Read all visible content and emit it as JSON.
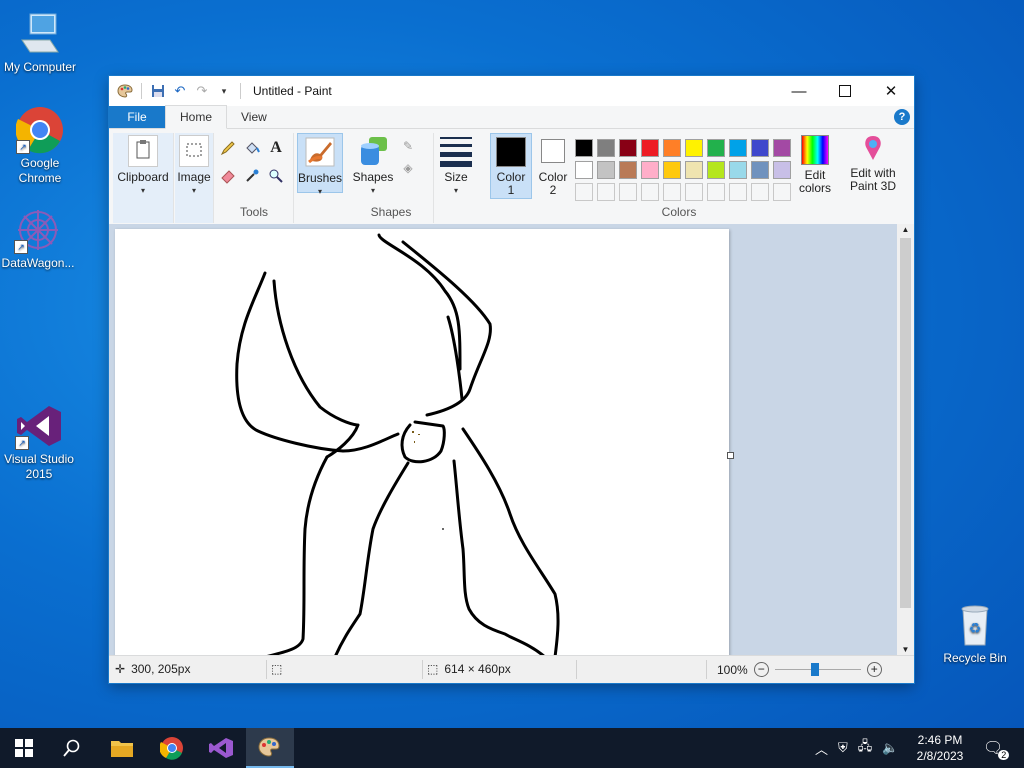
{
  "desktop": {
    "icons": [
      {
        "label": "My Computer",
        "icon": "computer-icon"
      },
      {
        "label": "Google Chrome",
        "icon": "chrome-icon"
      },
      {
        "label": "DataWagon...",
        "icon": "datawagon-icon"
      },
      {
        "label": "Visual Studio 2015",
        "icon": "visual-studio-icon"
      },
      {
        "label": "Recycle Bin",
        "icon": "recycle-bin-icon"
      }
    ]
  },
  "window": {
    "title": "Untitled - Paint",
    "tabs": [
      "File",
      "Home",
      "View"
    ],
    "active_tab": "Home",
    "ribbon": {
      "clipboard": "Clipboard",
      "image": "Image",
      "tools_group": "Tools",
      "brushes": "Brushes",
      "shapes": "Shapes",
      "shapes_group": "Shapes",
      "size": "Size",
      "color1_line1": "Color",
      "color1_line2": "1",
      "color2_line1": "Color",
      "color2_line2": "2",
      "colors_group": "Colors",
      "edit_colors_line1": "Edit",
      "edit_colors_line2": "colors",
      "paint3d_line1": "Edit with",
      "paint3d_line2": "Paint 3D"
    },
    "palette_row1": [
      "#000000",
      "#7f7f7f",
      "#880015",
      "#ed1c24",
      "#ff7f27",
      "#fff200",
      "#22b14c",
      "#00a2e8",
      "#3f48cc",
      "#a349a4"
    ],
    "palette_row2": [
      "#ffffff",
      "#c3c3c3",
      "#b97a57",
      "#ffaec9",
      "#ffc90e",
      "#efe4b0",
      "#b5e61d",
      "#99d9ea",
      "#7092be",
      "#c8bfe7"
    ],
    "color1": "#000000",
    "color2": "#ffffff",
    "status": {
      "cursor_pos": "300, 205px",
      "image_size": "614 × 460px",
      "zoom": "100%",
      "zoom_level": 1.0
    }
  },
  "taskbar": {
    "time": "2:46 PM",
    "date": "2/8/2023",
    "notification_count": "2"
  }
}
